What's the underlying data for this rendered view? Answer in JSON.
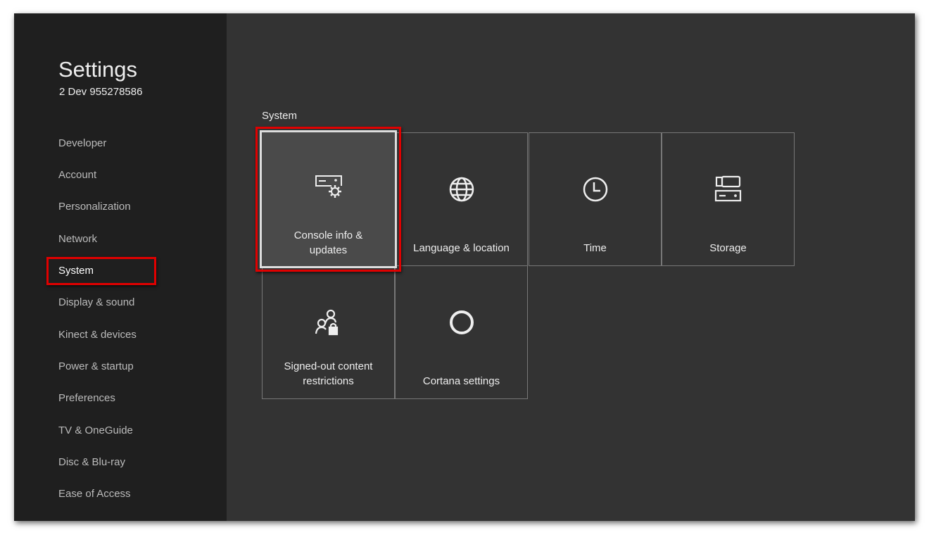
{
  "header": {
    "title": "Settings",
    "subtitle": "2 Dev 955278586"
  },
  "sidebar": {
    "items": [
      {
        "label": "Developer"
      },
      {
        "label": "Account"
      },
      {
        "label": "Personalization"
      },
      {
        "label": "Network"
      },
      {
        "label": "System",
        "active": true
      },
      {
        "label": "Display & sound"
      },
      {
        "label": "Kinect & devices"
      },
      {
        "label": "Power & startup"
      },
      {
        "label": "Preferences"
      },
      {
        "label": "TV & OneGuide"
      },
      {
        "label": "Disc & Blu-ray"
      },
      {
        "label": "Ease of Access"
      }
    ]
  },
  "main": {
    "section_title": "System",
    "tiles": [
      {
        "label": "Console info & updates",
        "icon": "console-gear-icon",
        "selected": true
      },
      {
        "label": "Language & location",
        "icon": "globe-icon"
      },
      {
        "label": "Time",
        "icon": "clock-icon"
      },
      {
        "label": "Storage",
        "icon": "storage-icon"
      },
      {
        "label": "Signed-out content restrictions",
        "icon": "users-lock-icon"
      },
      {
        "label": "Cortana settings",
        "icon": "cortana-icon"
      }
    ]
  },
  "colors": {
    "highlight": "#e00000",
    "sidebar": "#1f1f1f",
    "main": "#333333"
  }
}
